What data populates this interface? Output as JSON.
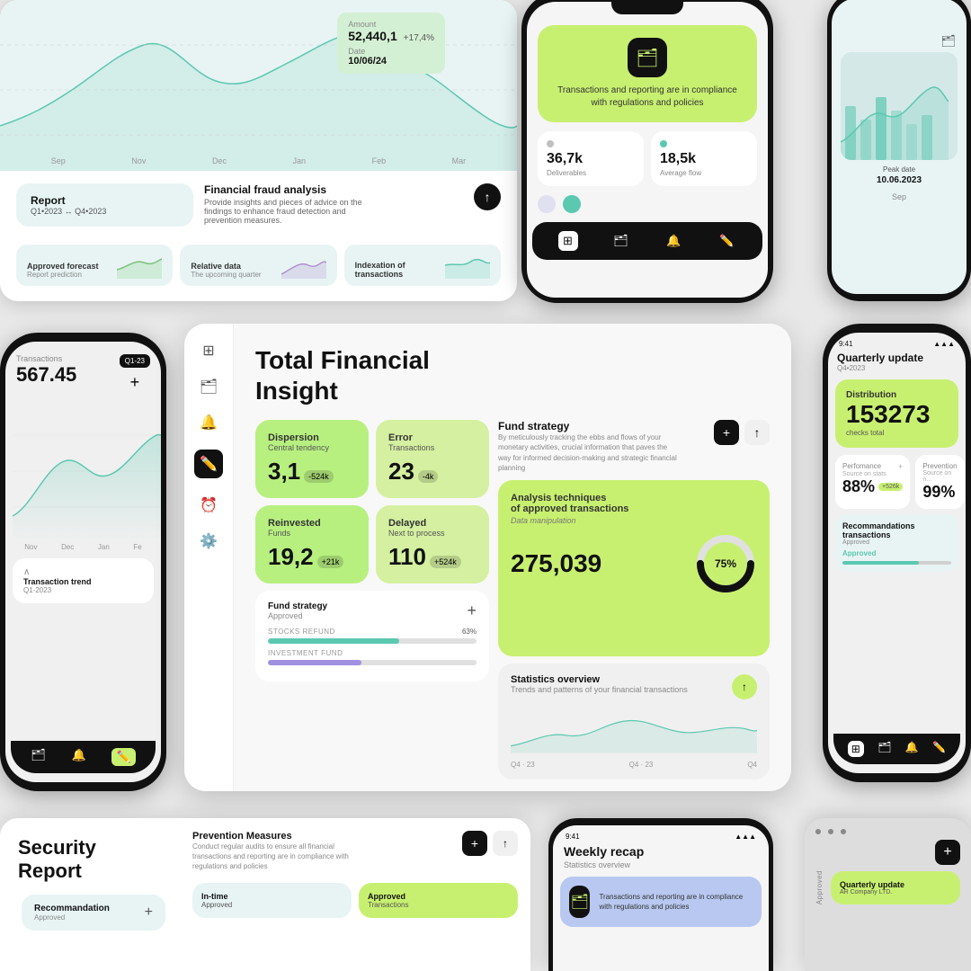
{
  "colors": {
    "bg": "#e0e0e0",
    "green_bright": "#c8f070",
    "green_light": "#b8f080",
    "teal": "#5bc8b0",
    "dark": "#111111",
    "card_bg": "#e8f4f4",
    "white": "#ffffff"
  },
  "top_left_chart": {
    "tooltip": {
      "amount_label": "Amount",
      "amount_value": "52,440,1",
      "change": "+17,4%",
      "date_label": "Date",
      "date_value": "10/06/24"
    },
    "x_labels": [
      "Sep",
      "Nov",
      "Dec",
      "Jan",
      "Feb",
      "Mar"
    ]
  },
  "report_section": {
    "label": "Report",
    "period": "Q1•2023 ↔ Q4•2023",
    "title": "Financial fraud analysis",
    "description": "Provide insights and pieces of advice on the findings to enhance fraud detection and prevention measures."
  },
  "bottom_tabs": [
    {
      "label": "Approved forecast",
      "sub": "Report prediction"
    },
    {
      "label": "Relative data",
      "sub": "The upcoming quarter"
    },
    {
      "label": "Indexation of transactions",
      "sub": ""
    }
  ],
  "phone_center_top": {
    "compliance_text": "Transactions and reporting are in compliance with regulations and policies",
    "stats": [
      {
        "value": "36,7k",
        "label": "Deliverables"
      },
      {
        "value": "18,5k",
        "label": "Average flow"
      }
    ]
  },
  "phone_right_top": {
    "peak_date_label": "Peak date",
    "peak_date_value": "10.06.2023",
    "month": "Sep"
  },
  "tablet_center": {
    "title": "Total Financial\nInsight",
    "fund_strategy": {
      "title": "Fund strategy",
      "description": "By meticulously tracking the ebbs and flows of your monetary activities, crucial information that paves the way for informed decision-making and strategic financial planning"
    },
    "metrics": [
      {
        "label": "Dispersion",
        "sub": "Central tendency",
        "value": "3,1",
        "change": "-524k"
      },
      {
        "label": "Error",
        "sub": "Transactions",
        "value": "23",
        "change": "-4k"
      },
      {
        "label": "Reinvested",
        "sub": "Funds",
        "value": "19,2",
        "change": "+21k"
      },
      {
        "label": "Delayed",
        "sub": "Next to process",
        "value": "110",
        "change": "+524k"
      }
    ],
    "analysis": {
      "title": "Analysis techniques of approved transactions",
      "subtitle": "Data manipulation",
      "number": "275,039",
      "percentage": 75
    },
    "statistics_overview": {
      "title": "Statistics overview",
      "subtitle": "Trends and patterns of your financial transactions"
    },
    "fund_strategy_card": {
      "title": "Fund strategy",
      "subtitle": "Approved",
      "bars": [
        {
          "label": "STOCKS REFUND",
          "pct": 63
        },
        {
          "label": "INVESTMENT FUND",
          "pct": 45
        }
      ]
    },
    "x_labels": [
      "Q4 · 23",
      "Q4 · 23",
      "Q4"
    ]
  },
  "phone_mid_left": {
    "label": "Transactions",
    "amount": "567.45",
    "quarter": "Q1-23",
    "x_labels": [
      "Nov",
      "Dec",
      "Jan",
      "Fe"
    ],
    "trend_label": "Transaction trend",
    "trend_period": "Q1-2023"
  },
  "phone_mid_right": {
    "status_time": "9:41",
    "title": "Quarterly update",
    "subtitle": "Q4•2023",
    "distribution": {
      "label": "Distribution",
      "number": "153273",
      "sub": "checks total"
    },
    "stats": [
      {
        "label": "Perfomance",
        "source": "Source on stats",
        "value": "88%",
        "badge": "+526k"
      },
      {
        "label": "Prevention",
        "source": "Source on n...",
        "value": "99%",
        "badge": ""
      }
    ],
    "recommandations": {
      "title": "Recommandations transactions",
      "subtitle": "Approved",
      "progress": 70
    }
  },
  "bottom_left": {
    "title": "Security Report",
    "recommandation": {
      "label": "Recommandation",
      "status": "Approved"
    },
    "prevention": {
      "title": "Prevention Measures",
      "description": "Conduct regular audits to ensure all financial transactions and reporting are in compliance with regulations and policies"
    },
    "cards": [
      {
        "label": "In-time",
        "sub": "Approved"
      },
      {
        "label": "Approved",
        "sub": "Transactions"
      }
    ]
  },
  "phone_bottom_center": {
    "time": "9:41",
    "title": "Weekly recap",
    "subtitle": "Statistics overview",
    "card_text": "Transactions and reporting are in compliance with regulations and policies"
  },
  "phone_bottom_right": {
    "approved": "Approved",
    "title": "Quarterly update",
    "company": "AR Company LTD."
  },
  "nav_icons": {
    "folder": "🗂",
    "bell": "🔔",
    "edit": "✏️",
    "grid": "⊞",
    "clock": "⏰",
    "settings": "⚙️"
  }
}
